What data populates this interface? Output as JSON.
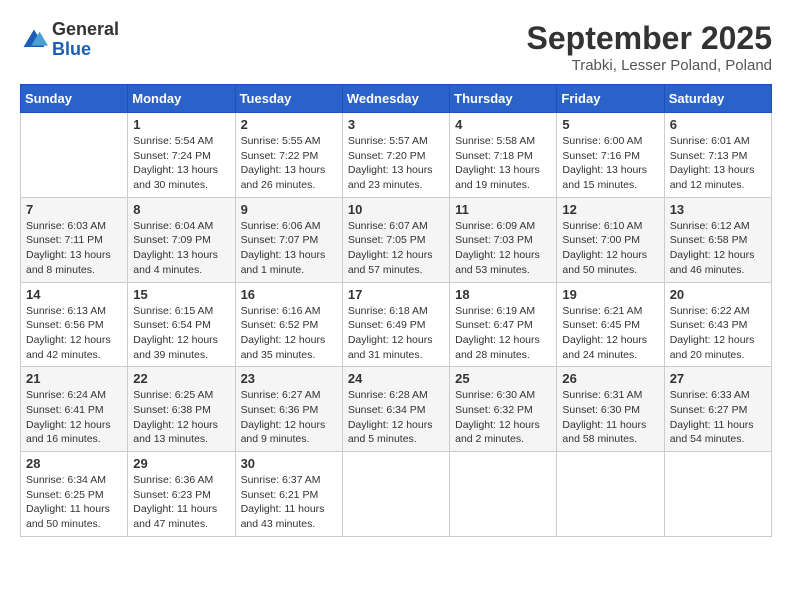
{
  "logo": {
    "general": "General",
    "blue": "Blue"
  },
  "title": "September 2025",
  "location": "Trabki, Lesser Poland, Poland",
  "header_days": [
    "Sunday",
    "Monday",
    "Tuesday",
    "Wednesday",
    "Thursday",
    "Friday",
    "Saturday"
  ],
  "weeks": [
    [
      {
        "day": "",
        "info": ""
      },
      {
        "day": "1",
        "info": "Sunrise: 5:54 AM\nSunset: 7:24 PM\nDaylight: 13 hours\nand 30 minutes."
      },
      {
        "day": "2",
        "info": "Sunrise: 5:55 AM\nSunset: 7:22 PM\nDaylight: 13 hours\nand 26 minutes."
      },
      {
        "day": "3",
        "info": "Sunrise: 5:57 AM\nSunset: 7:20 PM\nDaylight: 13 hours\nand 23 minutes."
      },
      {
        "day": "4",
        "info": "Sunrise: 5:58 AM\nSunset: 7:18 PM\nDaylight: 13 hours\nand 19 minutes."
      },
      {
        "day": "5",
        "info": "Sunrise: 6:00 AM\nSunset: 7:16 PM\nDaylight: 13 hours\nand 15 minutes."
      },
      {
        "day": "6",
        "info": "Sunrise: 6:01 AM\nSunset: 7:13 PM\nDaylight: 13 hours\nand 12 minutes."
      }
    ],
    [
      {
        "day": "7",
        "info": "Sunrise: 6:03 AM\nSunset: 7:11 PM\nDaylight: 13 hours\nand 8 minutes."
      },
      {
        "day": "8",
        "info": "Sunrise: 6:04 AM\nSunset: 7:09 PM\nDaylight: 13 hours\nand 4 minutes."
      },
      {
        "day": "9",
        "info": "Sunrise: 6:06 AM\nSunset: 7:07 PM\nDaylight: 13 hours\nand 1 minute."
      },
      {
        "day": "10",
        "info": "Sunrise: 6:07 AM\nSunset: 7:05 PM\nDaylight: 12 hours\nand 57 minutes."
      },
      {
        "day": "11",
        "info": "Sunrise: 6:09 AM\nSunset: 7:03 PM\nDaylight: 12 hours\nand 53 minutes."
      },
      {
        "day": "12",
        "info": "Sunrise: 6:10 AM\nSunset: 7:00 PM\nDaylight: 12 hours\nand 50 minutes."
      },
      {
        "day": "13",
        "info": "Sunrise: 6:12 AM\nSunset: 6:58 PM\nDaylight: 12 hours\nand 46 minutes."
      }
    ],
    [
      {
        "day": "14",
        "info": "Sunrise: 6:13 AM\nSunset: 6:56 PM\nDaylight: 12 hours\nand 42 minutes."
      },
      {
        "day": "15",
        "info": "Sunrise: 6:15 AM\nSunset: 6:54 PM\nDaylight: 12 hours\nand 39 minutes."
      },
      {
        "day": "16",
        "info": "Sunrise: 6:16 AM\nSunset: 6:52 PM\nDaylight: 12 hours\nand 35 minutes."
      },
      {
        "day": "17",
        "info": "Sunrise: 6:18 AM\nSunset: 6:49 PM\nDaylight: 12 hours\nand 31 minutes."
      },
      {
        "day": "18",
        "info": "Sunrise: 6:19 AM\nSunset: 6:47 PM\nDaylight: 12 hours\nand 28 minutes."
      },
      {
        "day": "19",
        "info": "Sunrise: 6:21 AM\nSunset: 6:45 PM\nDaylight: 12 hours\nand 24 minutes."
      },
      {
        "day": "20",
        "info": "Sunrise: 6:22 AM\nSunset: 6:43 PM\nDaylight: 12 hours\nand 20 minutes."
      }
    ],
    [
      {
        "day": "21",
        "info": "Sunrise: 6:24 AM\nSunset: 6:41 PM\nDaylight: 12 hours\nand 16 minutes."
      },
      {
        "day": "22",
        "info": "Sunrise: 6:25 AM\nSunset: 6:38 PM\nDaylight: 12 hours\nand 13 minutes."
      },
      {
        "day": "23",
        "info": "Sunrise: 6:27 AM\nSunset: 6:36 PM\nDaylight: 12 hours\nand 9 minutes."
      },
      {
        "day": "24",
        "info": "Sunrise: 6:28 AM\nSunset: 6:34 PM\nDaylight: 12 hours\nand 5 minutes."
      },
      {
        "day": "25",
        "info": "Sunrise: 6:30 AM\nSunset: 6:32 PM\nDaylight: 12 hours\nand 2 minutes."
      },
      {
        "day": "26",
        "info": "Sunrise: 6:31 AM\nSunset: 6:30 PM\nDaylight: 11 hours\nand 58 minutes."
      },
      {
        "day": "27",
        "info": "Sunrise: 6:33 AM\nSunset: 6:27 PM\nDaylight: 11 hours\nand 54 minutes."
      }
    ],
    [
      {
        "day": "28",
        "info": "Sunrise: 6:34 AM\nSunset: 6:25 PM\nDaylight: 11 hours\nand 50 minutes."
      },
      {
        "day": "29",
        "info": "Sunrise: 6:36 AM\nSunset: 6:23 PM\nDaylight: 11 hours\nand 47 minutes."
      },
      {
        "day": "30",
        "info": "Sunrise: 6:37 AM\nSunset: 6:21 PM\nDaylight: 11 hours\nand 43 minutes."
      },
      {
        "day": "",
        "info": ""
      },
      {
        "day": "",
        "info": ""
      },
      {
        "day": "",
        "info": ""
      },
      {
        "day": "",
        "info": ""
      }
    ]
  ]
}
